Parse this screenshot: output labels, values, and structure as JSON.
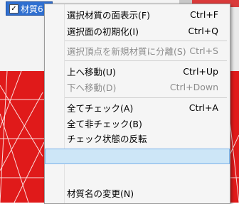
{
  "material_row": {
    "checked_mark": "✓",
    "label": "材質6"
  },
  "menu": {
    "items": [
      {
        "label": "選択材質の面表示(F)",
        "shortcut": "Ctrl+F",
        "disabled": false
      },
      {
        "label": "選択面の初期化(I)",
        "shortcut": "Ctrl+Q",
        "disabled": false
      },
      {
        "label": "選択頂点を新規材質に分離(S)",
        "shortcut": "Ctrl+S",
        "disabled": true
      },
      {
        "label": "上へ移動(U)",
        "shortcut": "Ctrl+Up",
        "disabled": false
      },
      {
        "label": "下へ移動(D)",
        "shortcut": "Ctrl+Down",
        "disabled": true
      },
      {
        "label": "全てチェック(A)",
        "shortcut": "Ctrl+A",
        "disabled": false
      },
      {
        "label": "全て非チェック(B)",
        "shortcut": "",
        "disabled": false
      },
      {
        "label": "チェック状態の反転",
        "shortcut": "",
        "disabled": false
      },
      {
        "label": "",
        "shortcut": "",
        "disabled": false
      },
      {
        "label": "材質名の変更(N)",
        "shortcut": "",
        "disabled": false
      }
    ]
  },
  "colors": {
    "viewport_red": "#e01a1a",
    "selection_blue": "#2f6fd0",
    "menu_highlight": "#cde6f7"
  }
}
